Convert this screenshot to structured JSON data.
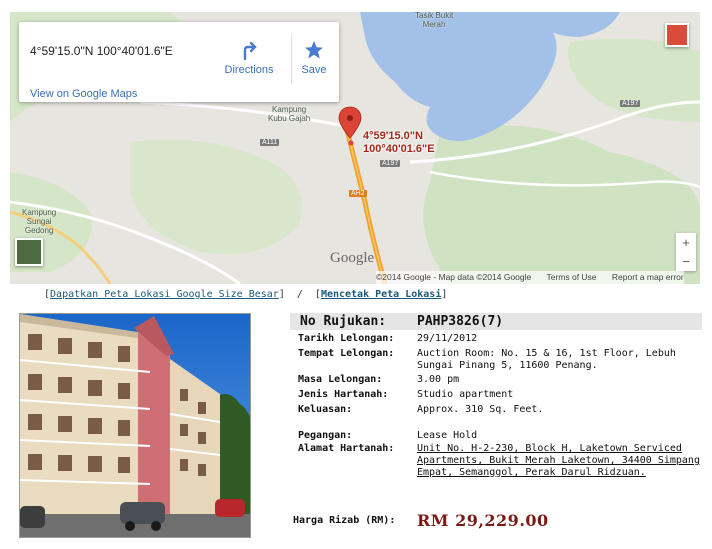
{
  "map": {
    "card": {
      "coords": "4°59'15.0\"N 100°40'01.6\"E",
      "directions_label": "Directions",
      "save_label": "Save",
      "view_link": "View on Google Maps"
    },
    "pin_label_line1": "4°59'15.0\"N",
    "pin_label_line2": "100°40'01.6\"E",
    "place_labels": {
      "tasik_line1": "Tasik Bukit",
      "tasik_line2": "Merah",
      "kubu_line1": "Kampung",
      "kubu_line2": "Kubu Gajah",
      "sungai_line1": "Kampung",
      "sungai_line2": "Sungai",
      "sungai_line3": "Gedong"
    },
    "road_shields": {
      "a197_top": "A197",
      "a197_mid": "A197",
      "a111": "A111",
      "ah2": "AH2"
    },
    "google_logo": "Google",
    "attribution": {
      "copyright": "©2014 Google - Map data ©2014 Google",
      "terms": "Terms of Use",
      "report": "Report a map error"
    },
    "zoom_in": "+",
    "zoom_out": "−",
    "colors": {
      "water": "#a3c0e8",
      "pin": "#db4437",
      "highway": "#f0a22c"
    }
  },
  "links": {
    "large_map": "Dapatkan Peta Lokasi Google Size Besar",
    "separator": "/",
    "print_map": "Mencetak Peta Lokasi"
  },
  "details": {
    "ref_label": "No Rujukan:",
    "ref_value": "PAHP3826(7)",
    "rows": [
      {
        "label": "Tarikh Lelongan:",
        "value": "29/11/2012"
      },
      {
        "label": "Tempat Lelongan:",
        "value": "Auction Room: No. 15 & 16, 1st Floor, Lebuh Sungai Pinang 5, 11600 Penang."
      },
      {
        "label": "Masa Lelongan:",
        "value": "3.00 pm"
      },
      {
        "label": "Jenis Hartanah:",
        "value": "Studio apartment"
      },
      {
        "label": "Keluasan:",
        "value": "Approx. 310 Sq. Feet."
      },
      {
        "label": "Pegangan:",
        "value": "Lease Hold"
      },
      {
        "label": "Alamat Hartanah:",
        "value": "Unit No. H-2-230, Block H, Laketown Serviced Apartments, Bukit Merah Laketown, 34400 Simpang Empat, Semanggol, Perak Darul Ridzuan."
      }
    ],
    "harga_label": "Harga Rizab (RM):",
    "harga_value": "RM 29,229.00"
  }
}
